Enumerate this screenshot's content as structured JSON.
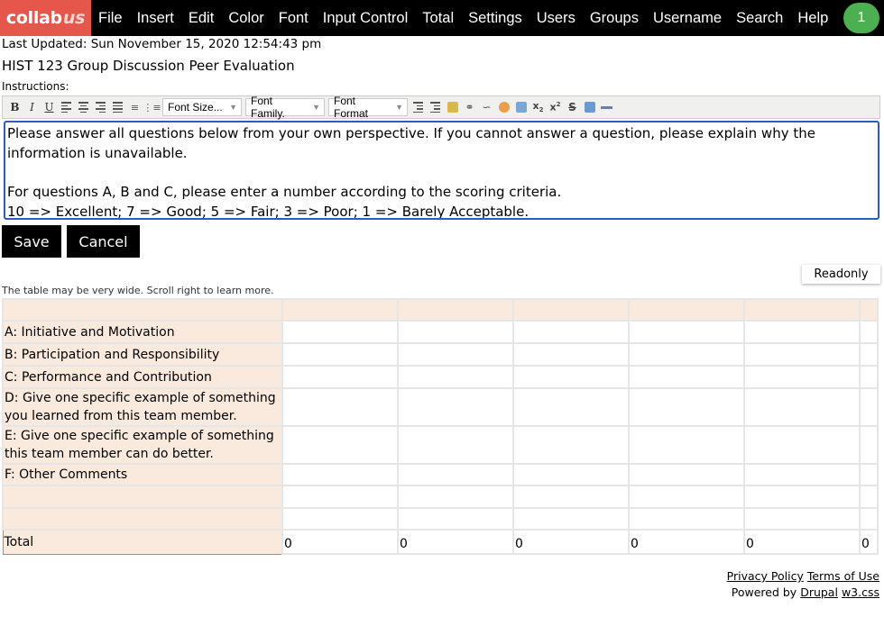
{
  "nav": {
    "logo_main": "collab",
    "logo_suffix": "us",
    "items": [
      "File",
      "Insert",
      "Edit",
      "Color",
      "Font",
      "Input Control",
      "Total",
      "Settings",
      "Users",
      "Groups",
      "Username",
      "Search",
      "Help"
    ],
    "badge": "1"
  },
  "last_updated": "Last Updated: Sun November 15, 2020 12:54:43 pm",
  "title": "HIST 123 Group Discussion Peer Evaluation",
  "instructions_label": "Instructions:",
  "toolbar": {
    "font_size": "Font Size...",
    "font_family": "Font Family.",
    "font_format": "Font Format"
  },
  "editor": {
    "line1": "Please answer all questions below from your own perspective. If you cannot answer a question, please explain why the information is unavailable.",
    "line2": "",
    "line3": "For questions A, B and C, please enter a number according to the scoring criteria.",
    "line4": "10 => Excellent; 7 => Good; 5 => Fair; 3 => Poor; 1 => Barely Acceptable."
  },
  "buttons": {
    "save": "Save",
    "cancel": "Cancel",
    "readonly": "Readonly"
  },
  "scroll_note": "The table may be very wide. Scroll right to learn more.",
  "table": {
    "rows": [
      "A: Initiative and Motivation",
      "B: Participation and Responsibility",
      "C: Performance and Contribution",
      "D: Give one specific example of something you learned from this team member.",
      "E: Give one specific example of something this team member can do better.",
      "F: Other Comments",
      "",
      ""
    ],
    "total_label": "Total",
    "totals": [
      "0",
      "0",
      "0",
      "0",
      "0",
      "0"
    ]
  },
  "footer": {
    "privacy": "Privacy Policy",
    "terms": "Terms of Use",
    "powered_by": "Powered by",
    "drupal": "Drupal",
    "w3css": "w3.css"
  }
}
